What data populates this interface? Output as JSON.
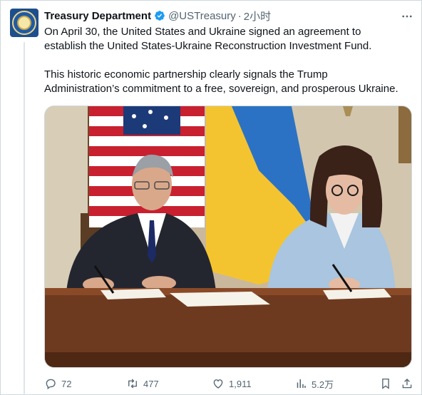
{
  "tweet": {
    "author_name": "Treasury Department",
    "author_handle": "@USTreasury",
    "separator": "·",
    "time_ago": "2小时",
    "paragraphs": [
      "On April 30, the United States and Ukraine signed an agreement to\nestablish the United States-Ukraine Reconstruction Investment Fund.",
      "This historic economic partnership clearly signals the Trump\nAdministration’s commitment to a free, sovereign, and prosperous Ukraine."
    ]
  },
  "icons": {
    "avatar": "treasury-seal",
    "verified": "verified-badge-icon",
    "more": "more-options-icon",
    "reply": "reply-icon",
    "repost": "repost-icon",
    "like": "like-icon",
    "views": "views-icon",
    "bookmark": "bookmark-icon",
    "share": "share-icon"
  },
  "colors": {
    "verified": "#1d9bf0",
    "text": "#0f1419",
    "muted": "#536471",
    "border": "#cfd9de"
  },
  "metrics": {
    "replies": "72",
    "reposts": "477",
    "likes": "1,911",
    "views": "5.2万"
  }
}
